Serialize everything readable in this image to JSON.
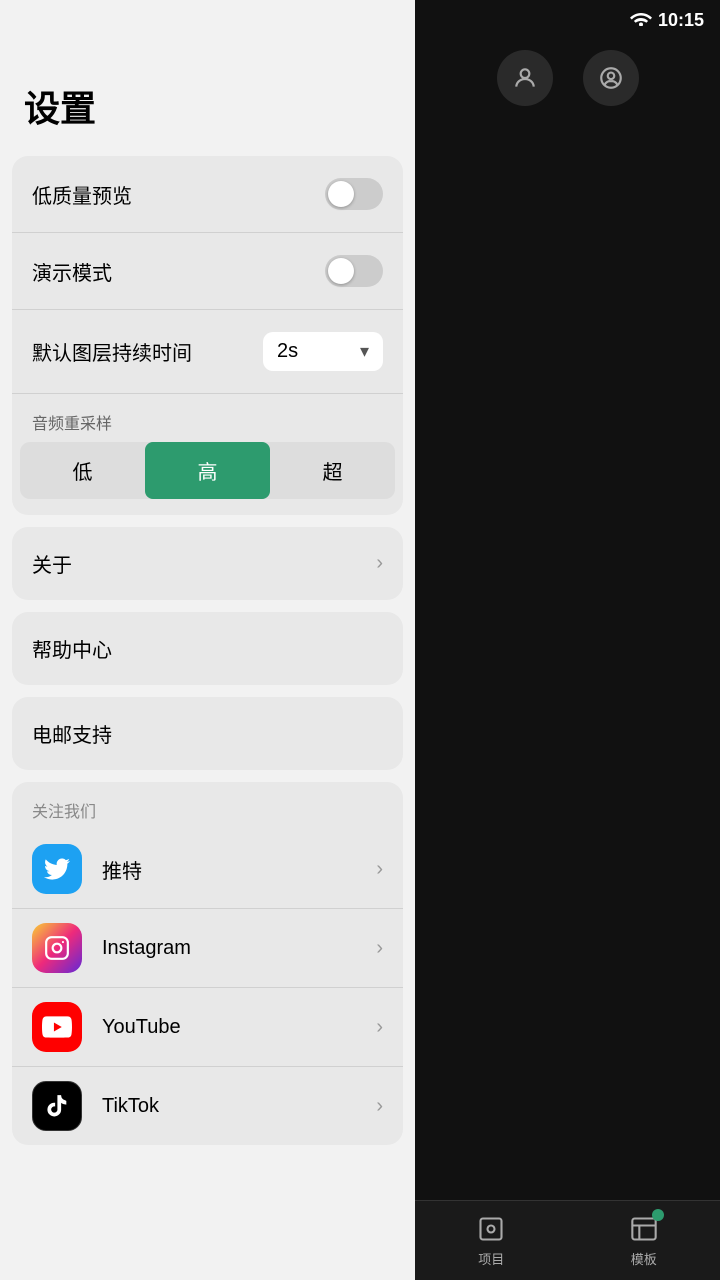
{
  "statusBar": {
    "time": "10:15",
    "wifiIcon": "wifi"
  },
  "settings": {
    "title": "设置",
    "lowQualityPreview": {
      "label": "低质量预览",
      "enabled": false
    },
    "demoMode": {
      "label": "演示模式",
      "enabled": false
    },
    "defaultLayerDuration": {
      "label": "默认图层持续时间",
      "value": "2s",
      "dropdownArrow": "▾"
    },
    "audioResample": {
      "sectionLabel": "音频重采样",
      "options": [
        "低",
        "高",
        "超"
      ],
      "activeIndex": 1
    },
    "about": {
      "label": "关于"
    },
    "helpCenter": {
      "label": "帮助中心"
    },
    "emailSupport": {
      "label": "电邮支持"
    },
    "followUs": {
      "sectionLabel": "关注我们",
      "items": [
        {
          "name": "推特",
          "platform": "twitter"
        },
        {
          "name": "Instagram",
          "platform": "instagram"
        },
        {
          "name": "YouTube",
          "platform": "youtube"
        },
        {
          "name": "TikTok",
          "platform": "tiktok"
        }
      ]
    }
  },
  "bottomNav": {
    "items": [
      {
        "label": "项目",
        "icon": "project"
      },
      {
        "label": "模板",
        "icon": "template",
        "hasBadge": true
      }
    ]
  }
}
